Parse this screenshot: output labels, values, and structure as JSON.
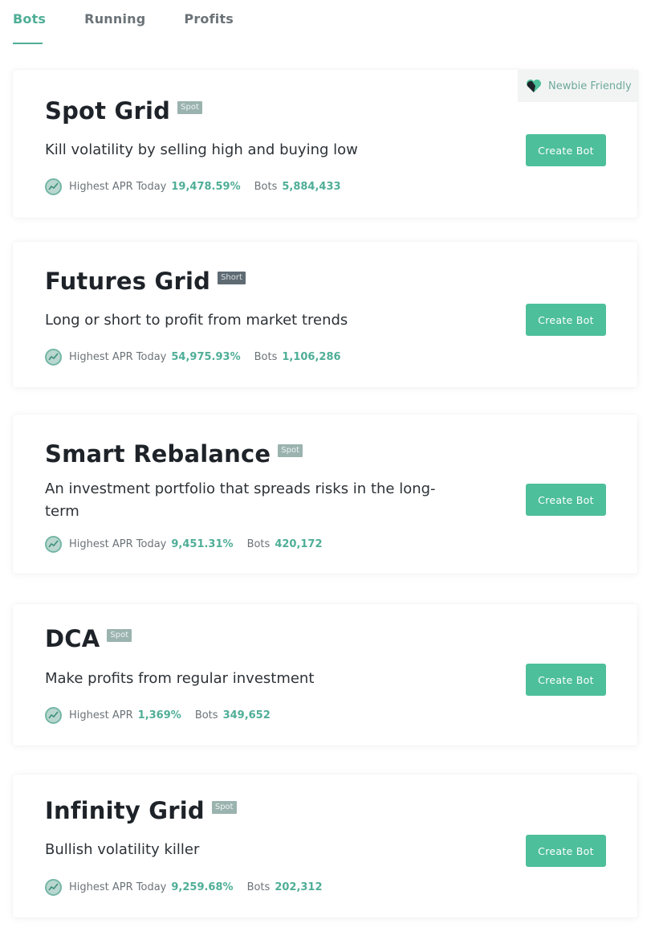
{
  "tabs": [
    {
      "label": "Bots",
      "active": true
    },
    {
      "label": "Running",
      "active": false
    },
    {
      "label": "Profits",
      "active": false
    }
  ],
  "newbie_badge": {
    "label": "Newbie Friendly",
    "icon": "heart-icon"
  },
  "cards": [
    {
      "title": "Spot Grid",
      "tag": "Spot",
      "description": "Kill volatility by selling high and buying low",
      "apr_label": "Highest APR Today",
      "apr_value": "19,478.59%",
      "bots_label": "Bots",
      "bots_value": "5,884,433",
      "button": "Create Bot"
    },
    {
      "title": "Futures Grid",
      "tag": "Short",
      "description": "Long or short to profit from market trends",
      "apr_label": "Highest APR Today",
      "apr_value": "54,975.93%",
      "bots_label": "Bots",
      "bots_value": "1,106,286",
      "button": "Create Bot"
    },
    {
      "title": "Smart Rebalance",
      "tag": "Spot",
      "description": "An investment portfolio that spreads risks in the long-term",
      "apr_label": "Highest APR Today",
      "apr_value": "9,451.31%",
      "bots_label": "Bots",
      "bots_value": "420,172",
      "button": "Create Bot"
    },
    {
      "title": "DCA",
      "tag": "Spot",
      "description": "Make profits from regular investment",
      "apr_label": "Highest APR",
      "apr_value": "1,369%",
      "bots_label": "Bots",
      "bots_value": "349,652",
      "button": "Create Bot"
    },
    {
      "title": "Infinity Grid",
      "tag": "Spot",
      "description": "Bullish volatility killer",
      "apr_label": "Highest APR Today",
      "apr_value": "9,259.68%",
      "bots_label": "Bots",
      "bots_value": "202,312",
      "button": "Create Bot"
    }
  ],
  "colors": {
    "accent": "#4fae97",
    "button": "#4dbf9a",
    "title": "#1e2329",
    "muted": "#6b7378"
  }
}
